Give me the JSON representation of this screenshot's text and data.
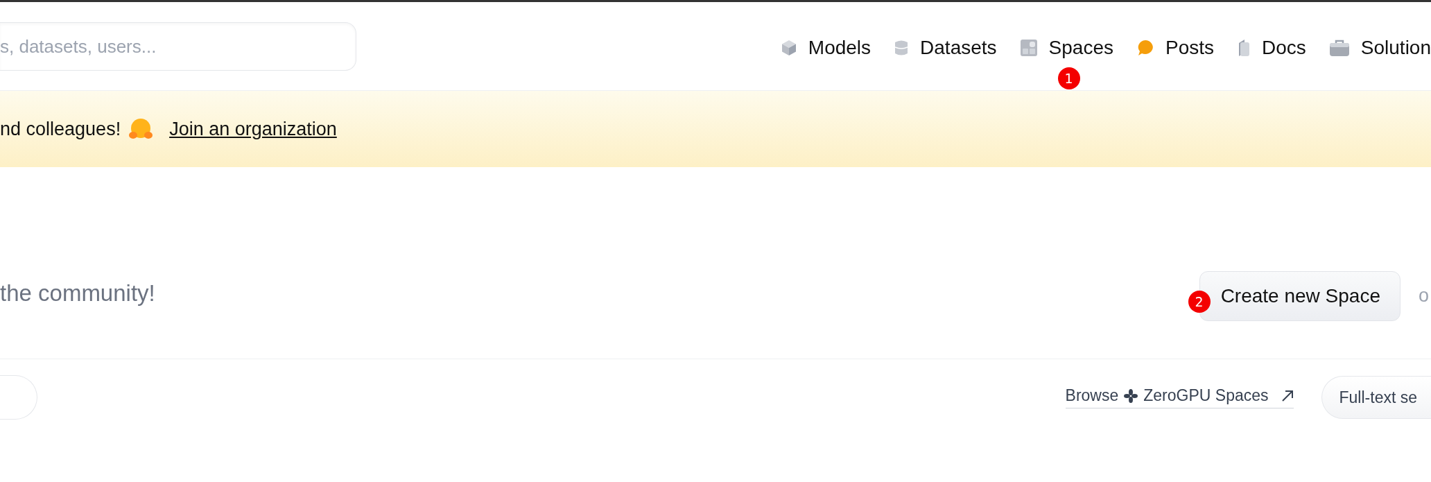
{
  "header": {
    "search": {
      "placeholder": "s, datasets, users..."
    },
    "nav": [
      {
        "label": "Models"
      },
      {
        "label": "Datasets"
      },
      {
        "label": "Spaces",
        "badge": "1"
      },
      {
        "label": "Posts"
      },
      {
        "label": "Docs"
      },
      {
        "label": "Solution"
      }
    ]
  },
  "banner": {
    "text": "nd colleagues!",
    "link": "Join an organization"
  },
  "hero": {
    "text": "the community!",
    "button": {
      "label": "Create new Space",
      "badge": "2"
    },
    "trailing": "o"
  },
  "toolbar": {
    "link": "Browse",
    "link_rest": "ZeroGPU Spaces",
    "button": "Full-text se"
  }
}
